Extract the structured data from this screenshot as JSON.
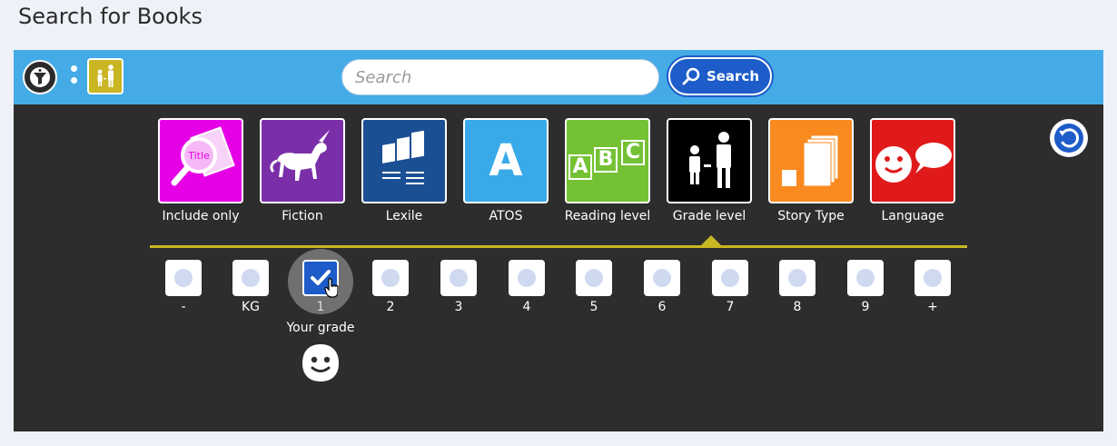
{
  "page": {
    "title": "Search for Books"
  },
  "toolbar": {
    "search_placeholder": "Search",
    "search_value": "",
    "search_button_label": "Search",
    "filter_icon": "funnel-icon",
    "grade_chip_icon": "adult-child-icon",
    "accent_color": "#45abe6"
  },
  "reset": {
    "icon": "reset-icon"
  },
  "categories": [
    {
      "label": "Include only",
      "color": "#e600e6",
      "icon": "magnifier-title-icon"
    },
    {
      "label": "Fiction",
      "color": "#7a2fa8",
      "icon": "unicorn-icon"
    },
    {
      "label": "Lexile",
      "color": "#1b4f94",
      "icon": "books-icon"
    },
    {
      "label": "ATOS",
      "color": "#3aa9e8",
      "icon": "letter-a-icon",
      "glyph": "A"
    },
    {
      "label": "Reading level",
      "color": "#74c234",
      "icon": "abc-blocks-icon",
      "letters": [
        "A",
        "B",
        "C"
      ]
    },
    {
      "label": "Grade level",
      "color": "#000000",
      "icon": "adult-child-icon",
      "active": true
    },
    {
      "label": "Story Type",
      "color": "#f88a1f",
      "icon": "pages-icon"
    },
    {
      "label": "Language",
      "color": "#e01a1a",
      "icon": "speech-face-icon"
    }
  ],
  "grades": {
    "options": [
      "-",
      "KG",
      "1",
      "2",
      "3",
      "4",
      "5",
      "6",
      "7",
      "8",
      "9",
      "+"
    ],
    "selected": "1",
    "your_grade_label": "Your grade",
    "your_grade_icon": "smiley-icon"
  }
}
